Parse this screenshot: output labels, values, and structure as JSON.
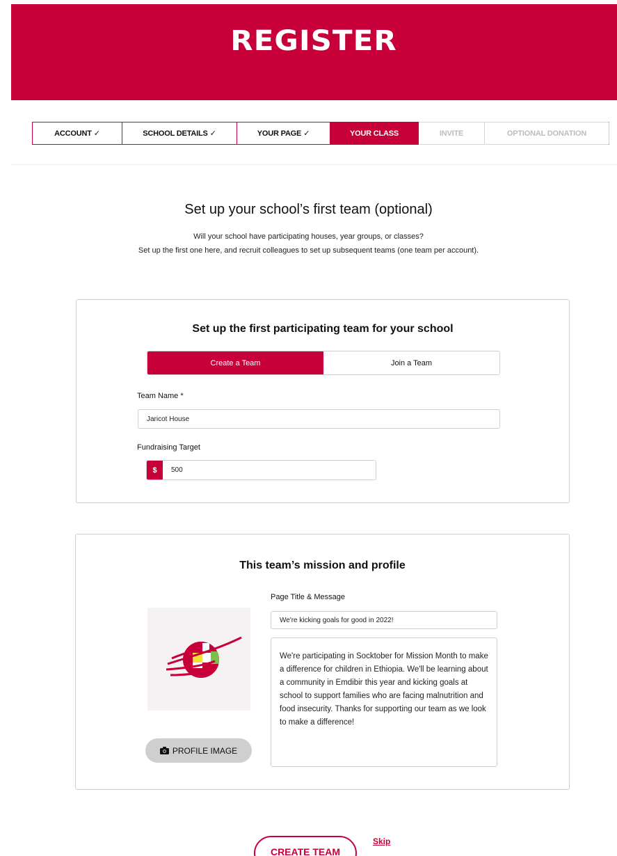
{
  "banner": {
    "title": "REGISTER"
  },
  "steps": [
    {
      "label": "ACCOUNT",
      "state": "done"
    },
    {
      "label": "SCHOOL DETAILS",
      "state": "done"
    },
    {
      "label": "YOUR PAGE",
      "state": "done"
    },
    {
      "label": "YOUR CLASS",
      "state": "active"
    },
    {
      "label": "INVITE",
      "state": "todo"
    },
    {
      "label": "OPTIONAL DONATION",
      "state": "todo"
    }
  ],
  "page": {
    "heading": "Set up your school’s first team (optional)",
    "intro_line1": "Will your school have participating houses, year groups, or classes?",
    "intro_line2": "Set up the first one here, and recruit colleagues to set up subsequent teams (one team per account)."
  },
  "team_card": {
    "title": "Set up the first participating team for your school",
    "toggle": {
      "create_label": "Create a Team",
      "join_label": "Join a Team",
      "selected": "create"
    },
    "team_name_label": "Team Name *",
    "team_name_value": "Jaricot House",
    "target_label": "Fundraising Target",
    "currency_symbol": "$",
    "target_value": "500"
  },
  "profile_card": {
    "title": "This team’s mission and profile",
    "page_title_label": "Page Title & Message",
    "page_title_value": "We're kicking goals for good in 2022!",
    "message_value": "We're participating in Socktober for Mission Month to make a difference for children in Ethiopia. We'll be learning about a community in Emdibir this year and kicking goals at school to support families who are facing malnutrition and food insecurity. Thanks for supporting our team as we look to make a difference!",
    "photo_button_label": "PROFILE IMAGE",
    "photo_button_icon": "camera-icon"
  },
  "actions": {
    "create_label": "CREATE TEAM",
    "skip_label": "Skip"
  },
  "colors": {
    "brand": "#c8003a",
    "border": "#cfcfcf",
    "disabled_text": "#bdbdbd"
  }
}
